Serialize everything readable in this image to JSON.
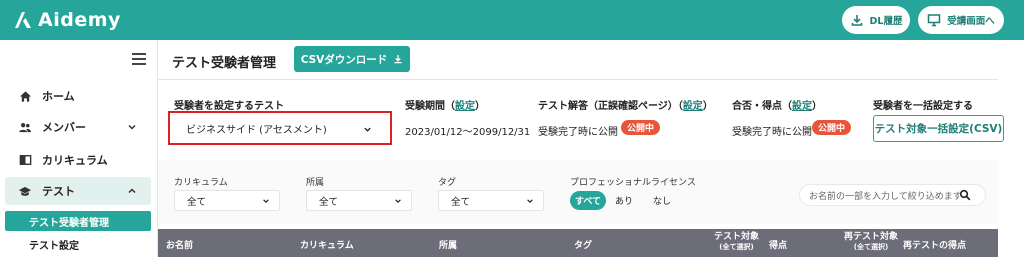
{
  "app": {
    "brand": "Aidemy",
    "header_buttons": {
      "dl_history": "DL履歴",
      "view_exam_screen": "受講画面へ"
    }
  },
  "sidebar": {
    "items": [
      {
        "label": "ホーム",
        "icon": "home-icon"
      },
      {
        "label": "メンバー",
        "icon": "people-icon",
        "expandable": true
      },
      {
        "label": "カリキュラム",
        "icon": "book-icon"
      },
      {
        "label": "テスト",
        "icon": "graduation-cap-icon",
        "expanded": true
      }
    ],
    "sub_items": [
      {
        "label": "テスト受験者管理",
        "active": true
      },
      {
        "label": "テスト設定",
        "active": false
      }
    ]
  },
  "main": {
    "title": "テスト受験者管理",
    "csv_download": "CSVダウンロード",
    "settings": {
      "target_test": {
        "label": "受験者を設定するテスト",
        "value": "ビジネスサイド (アセスメント)"
      },
      "period": {
        "label": "受験期間",
        "link": "設定",
        "value": "2023/01/12〜2099/12/31"
      },
      "answers": {
        "label": "テスト解答（正誤確認ページ）",
        "link": "設定",
        "value": "受験完了時に公開",
        "badge": "公開中"
      },
      "result": {
        "label": "合否・得点",
        "link": "設定",
        "value": "受験完了時に公開",
        "badge": "公開中"
      },
      "bulk": {
        "label": "受験者を一括設定する",
        "button": "テスト対象一括設定(CSV)"
      }
    },
    "filters": {
      "curriculum": {
        "label": "カリキュラム",
        "value": "全て"
      },
      "department": {
        "label": "所属",
        "value": "全て"
      },
      "tag": {
        "label": "タグ",
        "value": "全て"
      },
      "license": {
        "label": "プロフェッショナルライセンス",
        "options": [
          "すべて",
          "あり",
          "なし"
        ],
        "selected": "すべて"
      },
      "search_placeholder": "お名前の一部を入力して絞り込めます"
    },
    "table_headers": {
      "name": "お名前",
      "curriculum": "カリキュラム",
      "department": "所属",
      "tag": "タグ",
      "test_target": "テスト対象",
      "test_target_sub": "(全て選択)",
      "score": "得点",
      "retest_target": "再テスト対象",
      "retest_target_sub": "(全て選択)",
      "retest_score": "再テストの得点"
    }
  },
  "colors": {
    "brand": "#26a69a",
    "highlight": "#e02020",
    "badge": "#e8553b",
    "table_header": "#6d6d79"
  }
}
